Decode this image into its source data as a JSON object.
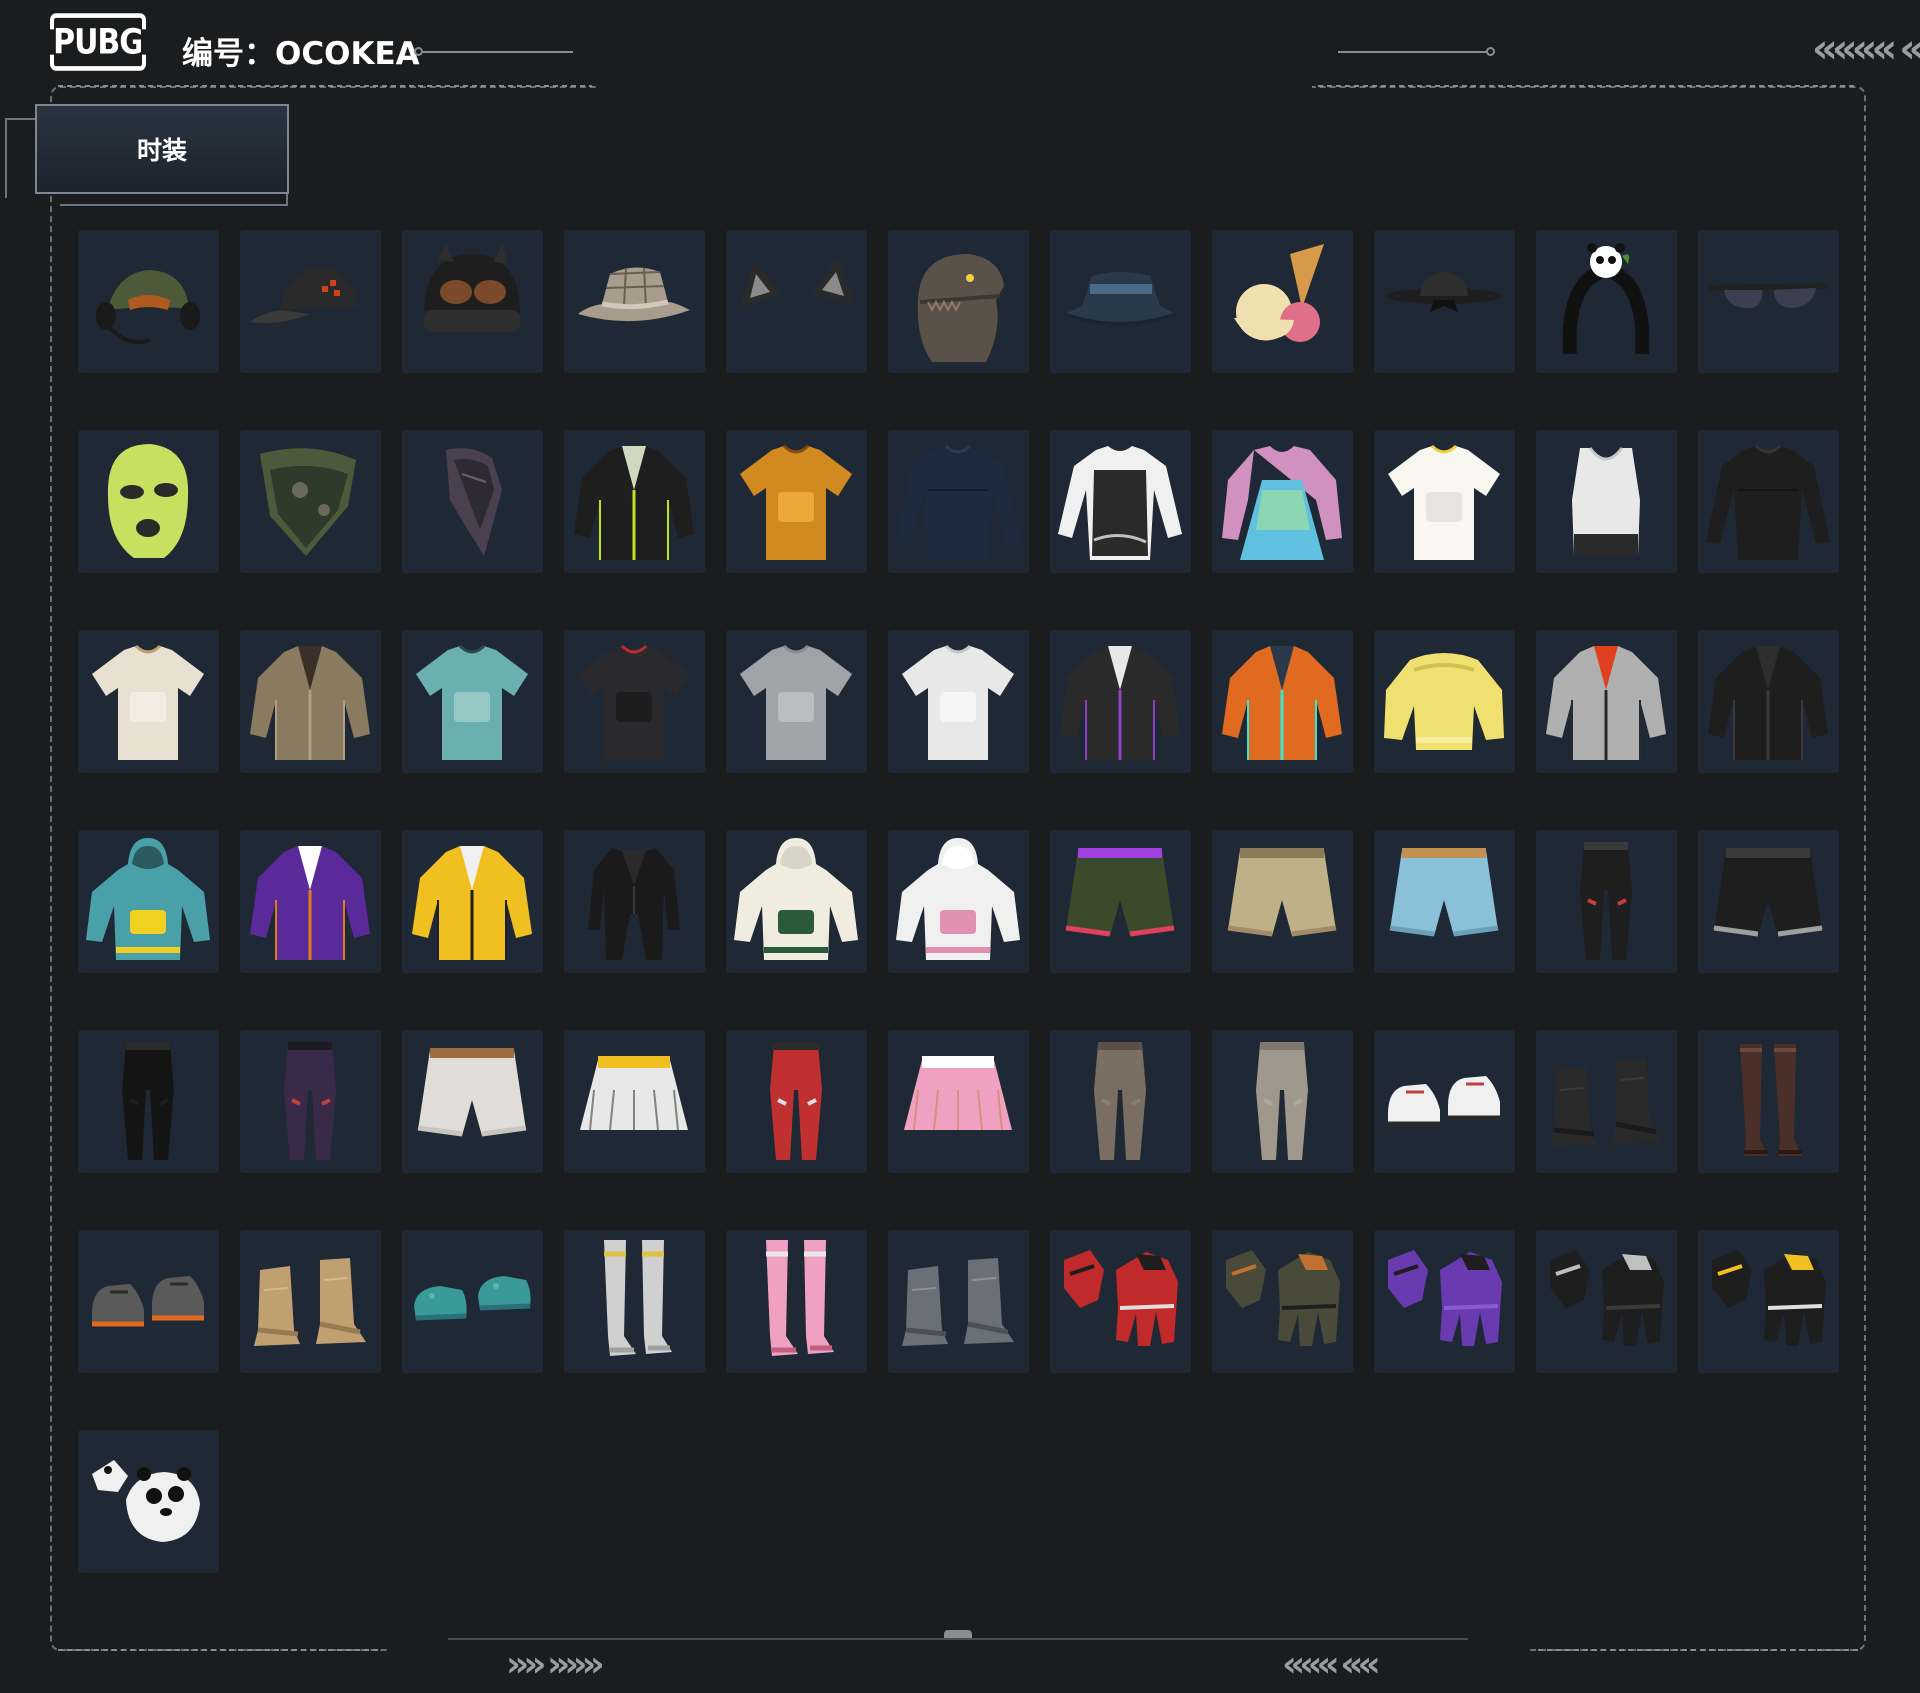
{
  "header": {
    "logo_text": "PUBG",
    "code_label": "编号：OCOKEA"
  },
  "decorations": {
    "top_right_chevrons": "«««« «",
    "bottom_left_chevrons": "»» »»»",
    "bottom_right_chevrons": "««« ««"
  },
  "category_tab": {
    "label": "时装"
  },
  "items": [
    {
      "name": "headset-cap",
      "icon": "headset-cap-icon",
      "colors": [
        "#4d5a3a",
        "#b05a20",
        "#1a1a1a"
      ]
    },
    {
      "name": "black-baseball-cap",
      "icon": "cap-icon",
      "colors": [
        "#2a2a2a",
        "#d0401a",
        "#3a3a3a"
      ]
    },
    {
      "name": "goggle-beanie",
      "icon": "beanie-goggles-icon",
      "colors": [
        "#1e1e1e",
        "#7a4a2a",
        "#2e2e2e"
      ]
    },
    {
      "name": "plaid-fedora",
      "icon": "fedora-icon",
      "colors": [
        "#a89c8c",
        "#6a5e50",
        "#d0c8bc"
      ]
    },
    {
      "name": "cat-ears",
      "icon": "cat-ears-icon",
      "colors": [
        "#2a2a2a",
        "#8a8a8a",
        "#111111"
      ]
    },
    {
      "name": "dinosaur-mask",
      "icon": "dino-head-icon",
      "colors": [
        "#5a5248",
        "#8a7a6a",
        "#3a3630"
      ]
    },
    {
      "name": "bucket-hat",
      "icon": "bucket-hat-icon",
      "colors": [
        "#2a3a4a",
        "#4a6a8a",
        "#1a2530"
      ]
    },
    {
      "name": "ice-cream-cone-hat",
      "icon": "ice-cream-icon",
      "colors": [
        "#d89a4a",
        "#f0e0b0",
        "#e0708a"
      ]
    },
    {
      "name": "black-wide-brim-hat",
      "icon": "wide-hat-icon",
      "colors": [
        "#1e1e1e",
        "#2e2e2e",
        "#111111"
      ]
    },
    {
      "name": "panda-headband",
      "icon": "panda-headband-icon",
      "colors": [
        "#111111",
        "#ffffff",
        "#4a8a3a"
      ]
    },
    {
      "name": "sunglasses",
      "icon": "sunglasses-icon",
      "colors": [
        "#222222",
        "#3a4050",
        "#111111"
      ]
    },
    {
      "name": "green-balaclava",
      "icon": "balaclava-icon",
      "colors": [
        "#c8e060",
        "#9ab040",
        "#2a2a2a"
      ]
    },
    {
      "name": "camo-bandana",
      "icon": "bandana-icon",
      "colors": [
        "#4a5a3a",
        "#2e3a2a",
        "#6a6a5a"
      ]
    },
    {
      "name": "purple-scarf",
      "icon": "scarf-icon",
      "colors": [
        "#4a4050",
        "#2e2a34",
        "#6a6070"
      ]
    },
    {
      "name": "black-lanyard-jacket",
      "icon": "jacket-icon",
      "colors": [
        "#1e1e1e",
        "#d0d8c0",
        "#c0e020"
      ]
    },
    {
      "name": "orange-print-tshirt",
      "icon": "tshirt-icon",
      "colors": [
        "#d08a20",
        "#8a4a10",
        "#f0b040"
      ]
    },
    {
      "name": "navy-turtleneck",
      "icon": "longsleeve-icon",
      "colors": [
        "#1e2a40",
        "#2a3a5a",
        "#141c2a"
      ]
    },
    {
      "name": "white-shirt-vest",
      "icon": "shirt-vest-icon",
      "colors": [
        "#f0f0f0",
        "#2a2a2a",
        "#c0c0c0"
      ]
    },
    {
      "name": "holographic-dress-cardigan",
      "icon": "dress-icon",
      "colors": [
        "#d090c0",
        "#60c0e0",
        "#a0e0a0"
      ]
    },
    {
      "name": "pikachu-tshirt",
      "icon": "tshirt-icon",
      "colors": [
        "#f8f8f0",
        "#f0d040",
        "#e0e0d8"
      ]
    },
    {
      "name": "white-sports-bra",
      "icon": "tanktop-icon",
      "colors": [
        "#e8e8e8",
        "#2a2a2a",
        "#c8c8c8"
      ]
    },
    {
      "name": "black-lace-top",
      "icon": "longsleeve-icon",
      "colors": [
        "#1e1e1e",
        "#3a3232",
        "#141414"
      ]
    },
    {
      "name": "embroidered-shirt",
      "icon": "tshirt-icon",
      "colors": [
        "#e8e0d0",
        "#c0a070",
        "#f4efe6"
      ]
    },
    {
      "name": "layered-vest-jacket",
      "icon": "jacket-icon",
      "colors": [
        "#8a7a60",
        "#3a3028",
        "#b0a080"
      ]
    },
    {
      "name": "floral-hawaiian-shirt",
      "icon": "tshirt-icon",
      "colors": [
        "#6ab0b0",
        "#2a4a4a",
        "#a0d0c8"
      ]
    },
    {
      "name": "black-crop-top",
      "icon": "tshirt-icon",
      "colors": [
        "#2a2a2e",
        "#c02a2a",
        "#1a1a1a"
      ]
    },
    {
      "name": "grey-tshirt",
      "icon": "tshirt-icon",
      "colors": [
        "#a0a4a8",
        "#888c90",
        "#c0c4c8"
      ]
    },
    {
      "name": "white-tshirt",
      "icon": "tshirt-icon",
      "colors": [
        "#e8e8e8",
        "#c8c8c8",
        "#f8f8f8"
      ]
    },
    {
      "name": "cyber-jacket",
      "icon": "jacket-icon",
      "colors": [
        "#2a2a2a",
        "#e8e8e8",
        "#8a40c0"
      ]
    },
    {
      "name": "orange-tech-jacket",
      "icon": "jacket-icon",
      "colors": [
        "#e06a20",
        "#2a3a4a",
        "#40e0d0"
      ]
    },
    {
      "name": "yellow-fleece-sweater",
      "icon": "sweater-icon",
      "colors": [
        "#f0e070",
        "#d0c050",
        "#f8f0a0"
      ]
    },
    {
      "name": "silver-red-jacket",
      "icon": "jacket-icon",
      "colors": [
        "#b0b0b0",
        "#e04020",
        "#2a2a2a"
      ]
    },
    {
      "name": "black-leather-jacket",
      "icon": "jacket-icon",
      "colors": [
        "#1e1e1e",
        "#2e2e2e",
        "#3a3a3a"
      ]
    },
    {
      "name": "teal-duck-hoodie",
      "icon": "hoodie-icon",
      "colors": [
        "#4aa0a8",
        "#f0d020",
        "#2a5a60"
      ]
    },
    {
      "name": "purple-team-jacket",
      "icon": "jacket-icon",
      "colors": [
        "#5a2a9a",
        "#ffffff",
        "#e07a20"
      ]
    },
    {
      "name": "yellow-white-jacket",
      "icon": "jacket-icon",
      "colors": [
        "#f0c020",
        "#f0f0f0",
        "#1e1e1e"
      ]
    },
    {
      "name": "black-suit",
      "icon": "suit-icon",
      "colors": [
        "#1a1a1a",
        "#2a2a2a",
        "#3a3a3a"
      ]
    },
    {
      "name": "cream-green-hoodie",
      "icon": "hoodie-icon",
      "colors": [
        "#f0ece0",
        "#2a5a3a",
        "#d8d4c8"
      ]
    },
    {
      "name": "pink-white-hoodie",
      "icon": "hoodie-icon",
      "colors": [
        "#f0f0f0",
        "#e090b0",
        "#ffffff"
      ]
    },
    {
      "name": "green-shorts-purple-socks",
      "icon": "shorts-icon",
      "colors": [
        "#3a4a2a",
        "#a040e0",
        "#e04060"
      ]
    },
    {
      "name": "camo-cargo-shorts",
      "icon": "shorts-icon",
      "colors": [
        "#c0b088",
        "#8a7a58",
        "#a08a68"
      ]
    },
    {
      "name": "denim-shorts",
      "icon": "shorts-icon",
      "colors": [
        "#8ac0d8",
        "#c09050",
        "#6aa0b8"
      ]
    },
    {
      "name": "black-cargo-pants",
      "icon": "pants-icon",
      "colors": [
        "#1e1e1e",
        "#3a3a3a",
        "#c04040"
      ]
    },
    {
      "name": "black-belted-shorts",
      "icon": "shorts-icon",
      "colors": [
        "#1e1e1e",
        "#3a3a3a",
        "#a0a0a0"
      ]
    },
    {
      "name": "black-skinny-jeans",
      "icon": "pants-icon",
      "colors": [
        "#141414",
        "#2a2a2a",
        "#1e1e1e"
      ]
    },
    {
      "name": "purple-combat-pants",
      "icon": "pants-icon",
      "colors": [
        "#3a2a4a",
        "#1e1a24",
        "#c04040"
      ]
    },
    {
      "name": "white-denim-shorts",
      "icon": "shorts-icon",
      "colors": [
        "#e0dcd8",
        "#a06a40",
        "#c8c4c0"
      ]
    },
    {
      "name": "white-pleated-skirt",
      "icon": "skirt-icon",
      "colors": [
        "#e8e8e8",
        "#f0c020",
        "#1e1e1e"
      ]
    },
    {
      "name": "red-camo-pants",
      "icon": "pants-icon",
      "colors": [
        "#c03030",
        "#2a2a2a",
        "#e0e0e0"
      ]
    },
    {
      "name": "pink-plaid-skirt",
      "icon": "skirt-icon",
      "colors": [
        "#f0a0c0",
        "#ffffff",
        "#c08040"
      ]
    },
    {
      "name": "khaki-pants",
      "icon": "pants-icon",
      "colors": [
        "#7a6e62",
        "#5a5048",
        "#8a7e72"
      ]
    },
    {
      "name": "beige-pants",
      "icon": "pants-icon",
      "colors": [
        "#a0988c",
        "#80786c",
        "#b0a89c"
      ]
    },
    {
      "name": "white-sneakers",
      "icon": "sneakers-icon",
      "colors": [
        "#f0f0f0",
        "#2a2a2a",
        "#c04040"
      ]
    },
    {
      "name": "black-leg-warmers",
      "icon": "boots-icon",
      "colors": [
        "#2a2a2a",
        "#1a1a1a",
        "#3a3a3a"
      ]
    },
    {
      "name": "brown-stockings",
      "icon": "stockings-icon",
      "colors": [
        "#4a3028",
        "#2a1a14",
        "#6a4a3a"
      ]
    },
    {
      "name": "grey-orange-sneakers",
      "icon": "sneakers-icon",
      "colors": [
        "#5a5a5a",
        "#e06a20",
        "#2a2a2a"
      ]
    },
    {
      "name": "tan-boots",
      "icon": "boots-icon",
      "colors": [
        "#c0a070",
        "#9a7a50",
        "#d8b888"
      ]
    },
    {
      "name": "teal-clogs",
      "icon": "clogs-icon",
      "colors": [
        "#3a9a98",
        "#2a7078",
        "#5ab8b0"
      ]
    },
    {
      "name": "white-thigh-boots",
      "icon": "tall-boots-icon",
      "colors": [
        "#d0d0d0",
        "#e0c040",
        "#a0a0a0"
      ]
    },
    {
      "name": "pink-fishnet-boots",
      "icon": "tall-boots-icon",
      "colors": [
        "#f0a0c0",
        "#e8e8e8",
        "#c06080"
      ]
    },
    {
      "name": "camo-combat-boots",
      "icon": "boots-icon",
      "colors": [
        "#6a7078",
        "#4a5058",
        "#8a9098"
      ]
    },
    {
      "name": "red-racing-gloves",
      "icon": "gloves-icon",
      "colors": [
        "#c02a2a",
        "#1e1e1e",
        "#e0e0e0"
      ]
    },
    {
      "name": "camo-tactical-gloves",
      "icon": "gloves-icon",
      "colors": [
        "#4a4a3a",
        "#c07030",
        "#1e1e1e"
      ]
    },
    {
      "name": "purple-gloves",
      "icon": "gloves-icon",
      "colors": [
        "#6a3ab0",
        "#1e1e1e",
        "#8a5ad0"
      ]
    },
    {
      "name": "black-knuckle-gloves",
      "icon": "gloves-icon",
      "colors": [
        "#1e1e1e",
        "#c0c0c0",
        "#3a3a3a"
      ]
    },
    {
      "name": "yellow-black-gloves",
      "icon": "gloves-icon",
      "colors": [
        "#1e1e1e",
        "#f0c020",
        "#e0e0e0"
      ]
    },
    {
      "name": "panda-gloves",
      "icon": "panda-gloves-icon",
      "colors": [
        "#f0f0f0",
        "#111111",
        "#d8d8d8"
      ]
    }
  ]
}
